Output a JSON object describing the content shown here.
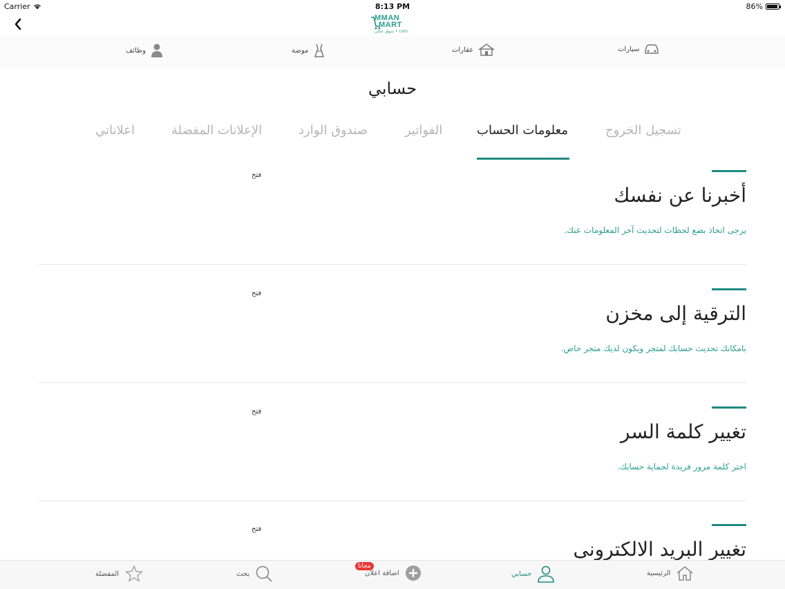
{
  "status": {
    "carrier": "Carrier",
    "time": "8:13 PM",
    "battery": "86%",
    "battery_level": 0.86
  },
  "logo": {
    "line1": "MMAN",
    "line2": "MART",
    "line3": "سوق عمان • com"
  },
  "categories": [
    {
      "label": "سيارات",
      "icon": "car-icon"
    },
    {
      "label": "عقارات",
      "icon": "house-icon"
    },
    {
      "label": "موضة",
      "icon": "fashion-icon"
    },
    {
      "label": "وظائف",
      "icon": "jobs-icon"
    }
  ],
  "page_title": "حسابي",
  "tabs": [
    {
      "label": "تسجيل الخروج",
      "active": false
    },
    {
      "label": "معلومات الحساب",
      "active": true
    },
    {
      "label": "الفواتير",
      "active": false
    },
    {
      "label": "صندوق الوارد",
      "active": false
    },
    {
      "label": "الإعلانات المفضلة",
      "active": false
    },
    {
      "label": "اعلاناتي",
      "active": false
    }
  ],
  "sections": [
    {
      "title": "أخبرنا عن نفسك",
      "desc": "يرجى اتخاذ بضع لحظات لتحديث آخر المعلومات عنك.",
      "open": "فتح"
    },
    {
      "title": "الترقية إلى مخزن",
      "desc": "بامكانك تحديث حسابك لمتجر ويكون لديك متجر خاص.",
      "open": "فتح"
    },
    {
      "title": "تغيير كلمة السر",
      "desc": "اختر كلمة مرور فريدة لحماية حسابك.",
      "open": "فتح"
    },
    {
      "title": "تغيير البريد الالكترونى",
      "desc": "",
      "open": "فتح"
    }
  ],
  "tab_bar": [
    {
      "label": "الرئيسية",
      "icon": "home-icon",
      "active": false
    },
    {
      "label": "حسابي",
      "icon": "user-icon",
      "active": true
    },
    {
      "label": "اضافة اعلان",
      "icon": "add-icon",
      "active": false,
      "badge": "مجانا"
    },
    {
      "label": "بحث",
      "icon": "search-icon",
      "active": false
    },
    {
      "label": "المفضلة",
      "icon": "star-icon",
      "active": false
    }
  ],
  "colors": {
    "accent": "#1e8a80",
    "link": "#2a9d8f",
    "badge": "#e53935"
  }
}
